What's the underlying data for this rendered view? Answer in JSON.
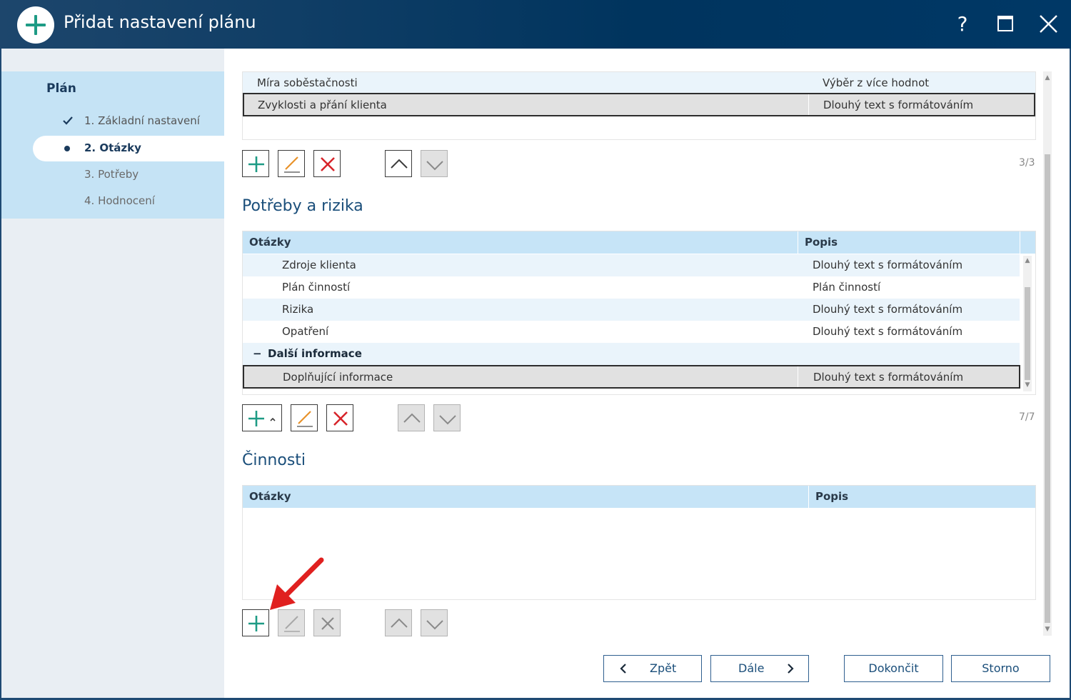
{
  "window": {
    "title": "Přidat nastavení plánu",
    "help_label": "?"
  },
  "sidebar": {
    "title": "Plán",
    "steps": [
      {
        "label": "1. Základní nastavení",
        "state": "done"
      },
      {
        "label": "2. Otázky",
        "state": "active"
      },
      {
        "label": "3. Potřeby",
        "state": "pending"
      },
      {
        "label": "4. Hodnocení",
        "state": "pending"
      }
    ]
  },
  "top_grid": {
    "rows": [
      {
        "question": "Míra soběstačnosti",
        "description": "Výběr z více hodnot"
      },
      {
        "question": "Zvyklosti a přání klienta",
        "description": "Dlouhý text s formátováním",
        "selected": true
      }
    ],
    "counter": "3/3"
  },
  "needs_section": {
    "title": "Potřeby a rizika",
    "headers": {
      "questions": "Otázky",
      "description": "Popis"
    },
    "rows": [
      {
        "question": "Zdroje klienta",
        "description": "Dlouhý text s formátováním"
      },
      {
        "question": "Plán činností",
        "description": "Plán činností"
      },
      {
        "question": "Rizika",
        "description": "Dlouhý text s formátováním"
      },
      {
        "question": "Opatření",
        "description": "Dlouhý text s formátováním"
      }
    ],
    "group": {
      "collapse_symbol": "−",
      "label": "Další informace"
    },
    "group_rows": [
      {
        "question": "Doplňující informace",
        "description": "Dlouhý text s formátováním",
        "selected": true
      }
    ],
    "counter": "7/7"
  },
  "activities_section": {
    "title": "Činnosti",
    "headers": {
      "questions": "Otázky",
      "description": "Popis"
    }
  },
  "footer": {
    "back_label": "Zpět",
    "next_label": "Dále",
    "finish_label": "Dokončit",
    "cancel_label": "Storno"
  },
  "colors": {
    "accent_green": "#1e9b85",
    "delete_red": "#d7242a",
    "edit_orange": "#e8922a",
    "annotation_arrow": "#e0201f",
    "titlebar": "#003866",
    "header_row": "#c6e4f7"
  },
  "icons": {
    "add": "plus-icon",
    "edit": "pencil-icon",
    "delete": "x-icon",
    "up": "chevron-up-icon",
    "down": "chevron-down-icon"
  }
}
